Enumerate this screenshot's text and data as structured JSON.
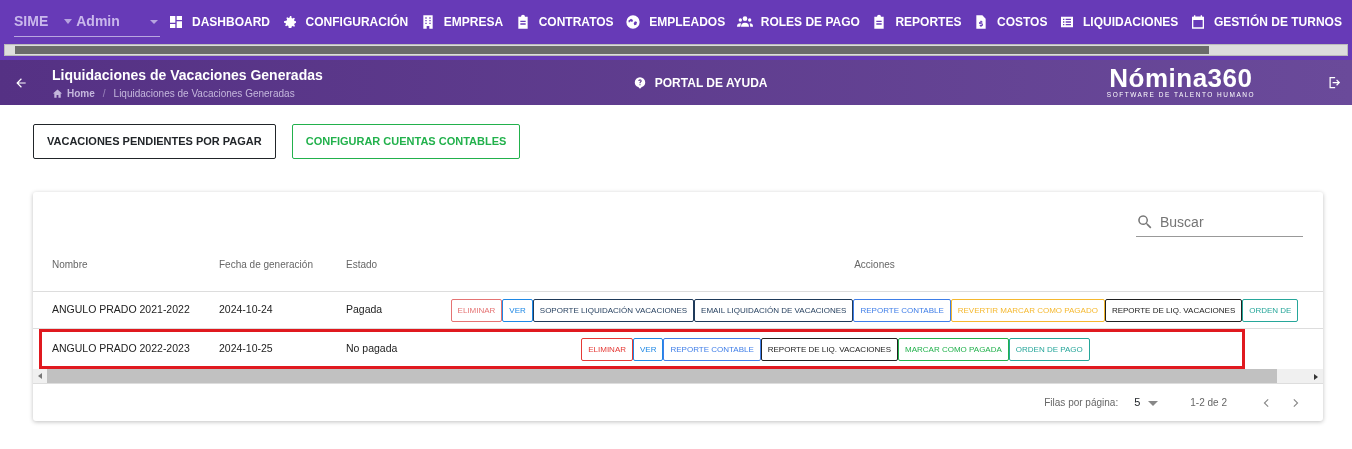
{
  "topbar": {
    "company": "SIME",
    "user": "Admin",
    "menu": [
      {
        "label": "DASHBOARD"
      },
      {
        "label": "CONFIGURACIÓN"
      },
      {
        "label": "EMPRESA"
      },
      {
        "label": "CONTRATOS"
      },
      {
        "label": "EMPLEADOS"
      },
      {
        "label": "ROLES DE PAGO"
      },
      {
        "label": "REPORTES"
      },
      {
        "label": "COSTOS"
      },
      {
        "label": "LIQUIDACIONES"
      },
      {
        "label": "GESTIÓN DE TURNOS"
      }
    ]
  },
  "header": {
    "title": "Liquidaciones de Vacaciones Generadas",
    "breadcrumb": [
      "Home",
      "Liquidaciones de Vacaciones Generadas"
    ],
    "breadcrumb_separator": "/",
    "help": "PORTAL DE AYUDA",
    "logo": "Nómina360",
    "logo_tagline": "SOFTWARE DE TALENTO HUMANO"
  },
  "toolbar": [
    {
      "label": "VACACIONES PENDIENTES POR PAGAR",
      "color": "#212529"
    },
    {
      "label": "CONFIGURAR CUENTAS CONTABLES",
      "color": "#22b14c"
    }
  ],
  "table": {
    "search": {
      "placeholder": "Buscar"
    },
    "columns": [
      "Nombre",
      "Fecha de generación",
      "Estado",
      "Acciones"
    ],
    "rows": [
      {
        "cells": [
          "ANGULO PRADO 2021-2022",
          "2024-10-24",
          "Pagada"
        ],
        "highlighted": false,
        "actions": [
          {
            "label": "ELIMINAR",
            "color": "#e57373"
          },
          {
            "label": "VER",
            "color": "#1e88e5"
          },
          {
            "label": "SOPORTE LIQUIDACIÓN VACACIONES",
            "color": "#1f3a5a"
          },
          {
            "label": "EMAIL LIQUIDACIÓN DE VACACIONES",
            "color": "#1f3a5a"
          },
          {
            "label": "REPORTE CONTABLE",
            "color": "#3f7ee8"
          },
          {
            "label": "REVERTIR MARCAR COMO PAGADO",
            "color": "#f5b82e"
          },
          {
            "label": "REPORTE DE LIQ. VACACIONES",
            "color": "#212121"
          },
          {
            "label": "ORDEN DE",
            "color": "#26a69a"
          }
        ]
      },
      {
        "cells": [
          "ANGULO PRADO 2022-2023",
          "2024-10-25",
          "No pagada"
        ],
        "highlighted": true,
        "actions": [
          {
            "label": "ELIMINAR",
            "color": "#e53935"
          },
          {
            "label": "VER",
            "color": "#1e88e5"
          },
          {
            "label": "REPORTE CONTABLE",
            "color": "#3f7ee8"
          },
          {
            "label": "REPORTE DE LIQ. VACACIONES",
            "color": "#212121"
          },
          {
            "label": "MARCAR COMO PAGADA",
            "color": "#22b14c"
          },
          {
            "label": "ORDEN DE PAGO",
            "color": "#26a69a"
          }
        ]
      }
    ],
    "footer": {
      "rows_label": "Filas por página:",
      "rows_value": "5",
      "range": "1-2 de 2"
    }
  }
}
